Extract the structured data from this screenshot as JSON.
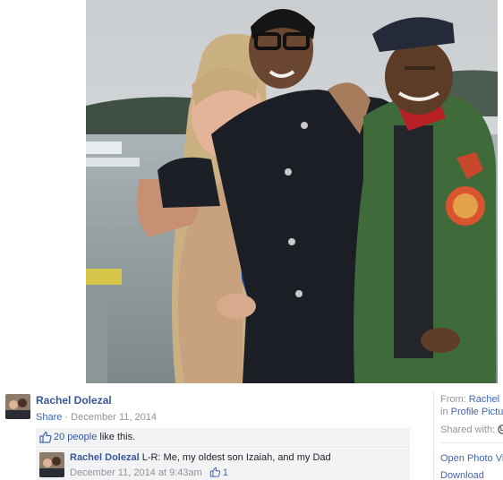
{
  "post": {
    "author": "Rachel Dolezal",
    "share_label": "Share",
    "separator": " · ",
    "date": "December 11, 2014",
    "likes_count_label": "20 people",
    "likes_suffix": " like this."
  },
  "comment": {
    "author": "Rachel Dolezal",
    "text": "L-R: Me, my oldest son Izaiah, and my Dad",
    "timestamp": "December 11, 2014 at 9:43am",
    "like_count": "1"
  },
  "sidebar": {
    "from_label": "From: ",
    "from_name": "Rachel D",
    "in_label": "in ",
    "album": "Profile Pictur",
    "shared_with_label": "Shared with:",
    "open_photo_viewer": "Open Photo Vi",
    "download": "Download"
  },
  "colors": {
    "link": "#365899",
    "muted": "#90949c",
    "panel": "#f2f3f5"
  },
  "icons": {
    "like": "thumbs-up-icon",
    "privacy": "globe-icon"
  }
}
